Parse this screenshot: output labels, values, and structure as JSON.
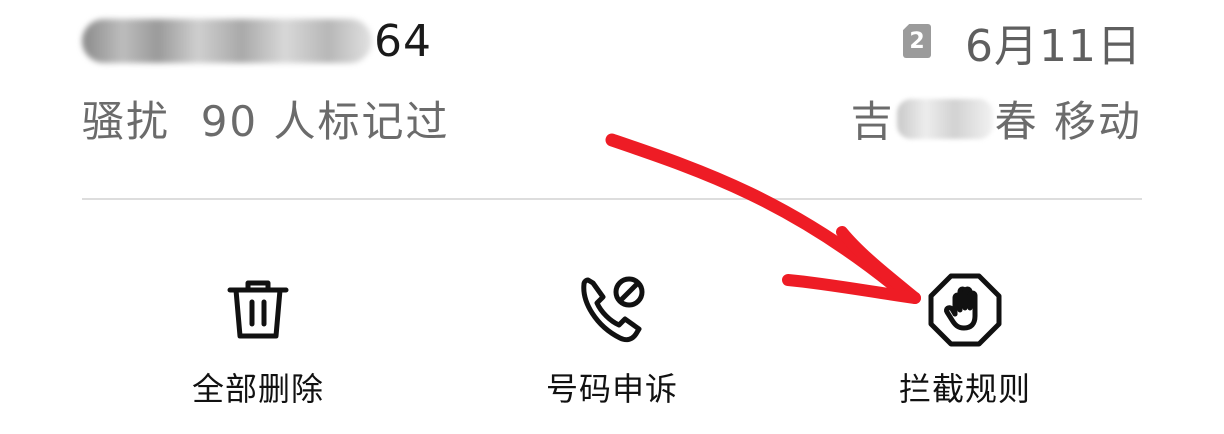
{
  "record": {
    "phone_number_visible_tail": "64",
    "sim_badge": "2",
    "date": "6月11日",
    "tag": "骚扰  90 人标记过",
    "location_prefix": "吉",
    "location_suffix": "春 移动"
  },
  "actions": [
    {
      "label": "全部删除",
      "icon": "trash-icon"
    },
    {
      "label": "号码申诉",
      "icon": "phone-blocked-icon"
    },
    {
      "label": "拦截规则",
      "icon": "hand-stop-icon"
    }
  ],
  "annotation": {
    "color": "#ee1c25",
    "type": "hand-drawn-arrow"
  }
}
